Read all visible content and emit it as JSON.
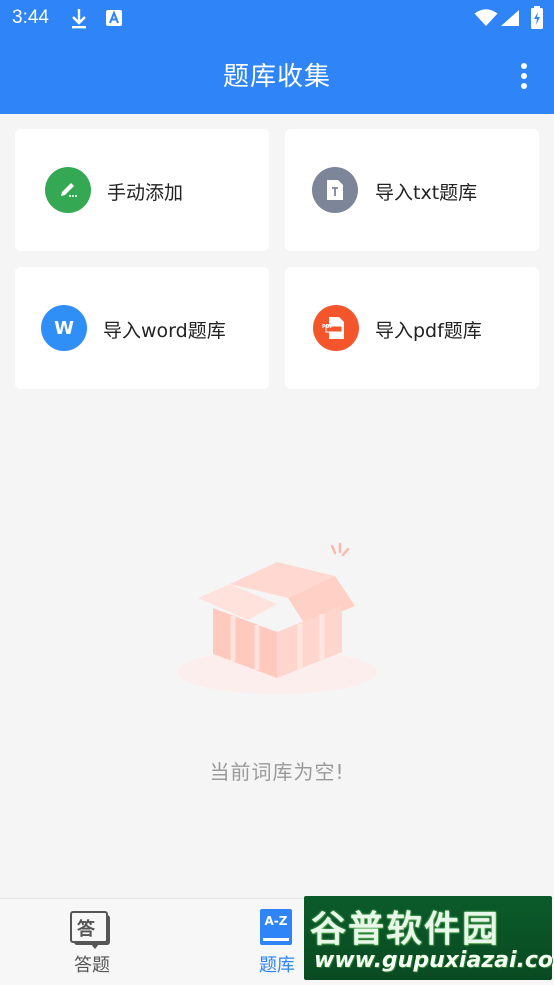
{
  "status_bar": {
    "time": "3:44"
  },
  "app_bar": {
    "title": "题库收集"
  },
  "cards": [
    {
      "label": "手动添加",
      "color": "#34a853",
      "icon": "pencil-icon"
    },
    {
      "label": "导入txt题库",
      "color": "#7c8698",
      "icon": "txt-file-icon"
    },
    {
      "label": "导入word题库",
      "color": "#2f8ff6",
      "icon": "word-icon",
      "icon_text": "W"
    },
    {
      "label": "导入pdf题库",
      "color": "#f4552b",
      "icon": "pdf-file-icon",
      "icon_text": "PDF"
    }
  ],
  "empty_state": {
    "message": "当前词库为空!"
  },
  "bottom_nav": {
    "tabs": [
      {
        "label": "答题",
        "icon": "answer-icon",
        "icon_text": "答",
        "active": false
      },
      {
        "label": "题库",
        "icon": "a-z-book-icon",
        "icon_text": "A-Z",
        "active": true
      }
    ],
    "active_color": "#2f84f7",
    "inactive_color": "#555555"
  },
  "watermark": {
    "brand": "谷普软件园",
    "url": "www.gupuxiazai.com"
  }
}
